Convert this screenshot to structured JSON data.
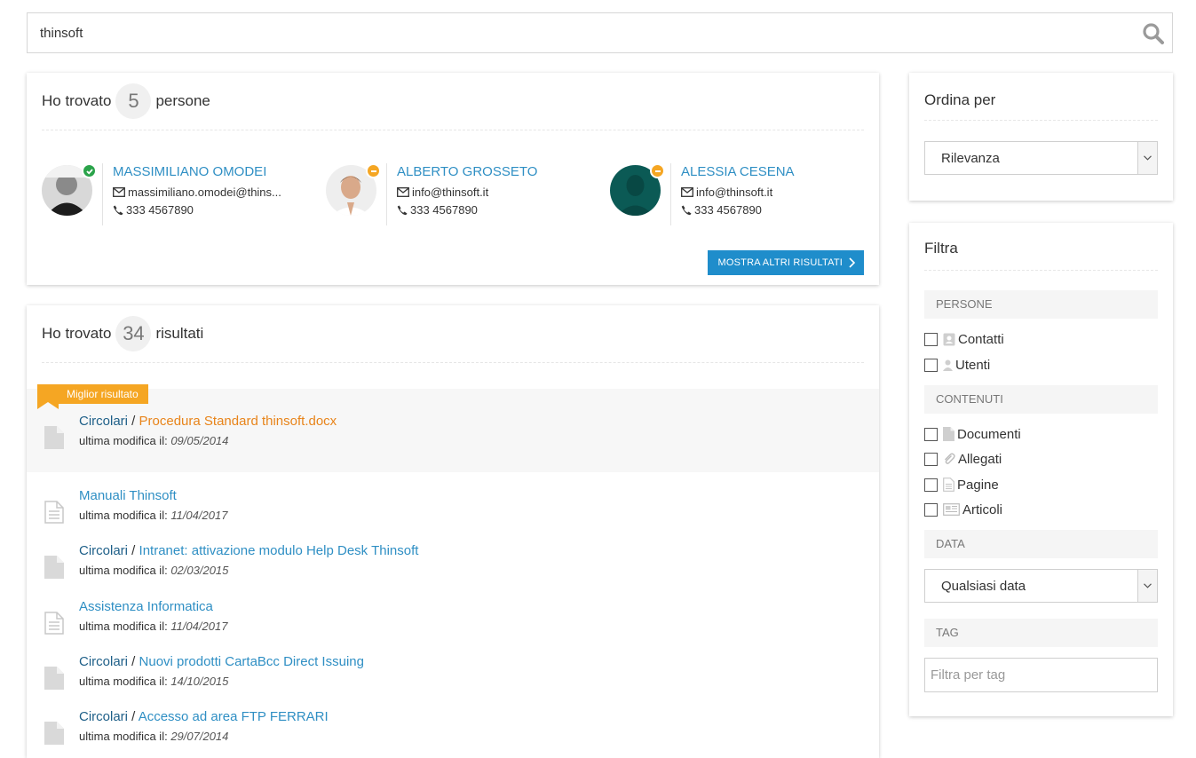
{
  "search": {
    "value": "thinsoft"
  },
  "people_card": {
    "title_pre": "Ho trovato",
    "count": "5",
    "title_post": "persone",
    "more_label": "MOSTRA ALTRI RISULTATI",
    "people": [
      {
        "name": "MASSIMILIANO OMODEI",
        "email": "massimiliano.omodei@thins...",
        "phone": "333 4567890",
        "status": "online"
      },
      {
        "name": "ALBERTO GROSSETO",
        "email": "info@thinsoft.it",
        "phone": "333 4567890",
        "status": "away"
      },
      {
        "name": "ALESSIA CESENA",
        "email": "info@thinsoft.it",
        "phone": "333 4567890",
        "status": "away"
      }
    ]
  },
  "results_card": {
    "title_pre": "Ho trovato",
    "count": "34",
    "title_post": "risultati",
    "best_label": "Miglior risultato",
    "meta_label": "ultima modifica il:",
    "items": [
      {
        "category": "Circolari",
        "separator": " / ",
        "title": "Procedura Standard thinsoft.docx",
        "date": "09/05/2014",
        "icon": "file-icon"
      },
      {
        "category": "",
        "separator": "",
        "title": "Manuali Thinsoft",
        "date": "11/04/2017",
        "icon": "page-icon"
      },
      {
        "category": "Circolari",
        "separator": " / ",
        "title": "Intranet: attivazione modulo Help Desk Thinsoft",
        "date": "02/03/2015",
        "icon": "file-icon"
      },
      {
        "category": "",
        "separator": "",
        "title": "Assistenza Informatica",
        "date": "11/04/2017",
        "icon": "page-icon"
      },
      {
        "category": "Circolari",
        "separator": " / ",
        "title": "Nuovi prodotti CartaBcc Direct Issuing",
        "date": "14/10/2015",
        "icon": "file-icon"
      },
      {
        "category": "Circolari",
        "separator": " / ",
        "title": "Accesso ad area FTP FERRARI",
        "date": "29/07/2014",
        "icon": "file-icon"
      }
    ]
  },
  "sort_card": {
    "title": "Ordina per",
    "selected": "Rilevanza"
  },
  "filter_card": {
    "title": "Filtra",
    "persone_header": "PERSONE",
    "contatti": "Contatti",
    "utenti": "Utenti",
    "contenuti_header": "CONTENUTI",
    "documenti": "Documenti",
    "allegati": "Allegati",
    "pagine": "Pagine",
    "articoli": "Articoli",
    "data_header": "DATA",
    "data_selected": "Qualsiasi data",
    "tag_header": "TAG",
    "tag_placeholder": "Filtra per tag"
  },
  "colors": {
    "link": "#2f8fc4",
    "best": "#e8841a",
    "ribbon": "#f5a623",
    "button": "#1f8dcb",
    "online": "#2aa34a",
    "away": "#f5a623"
  }
}
